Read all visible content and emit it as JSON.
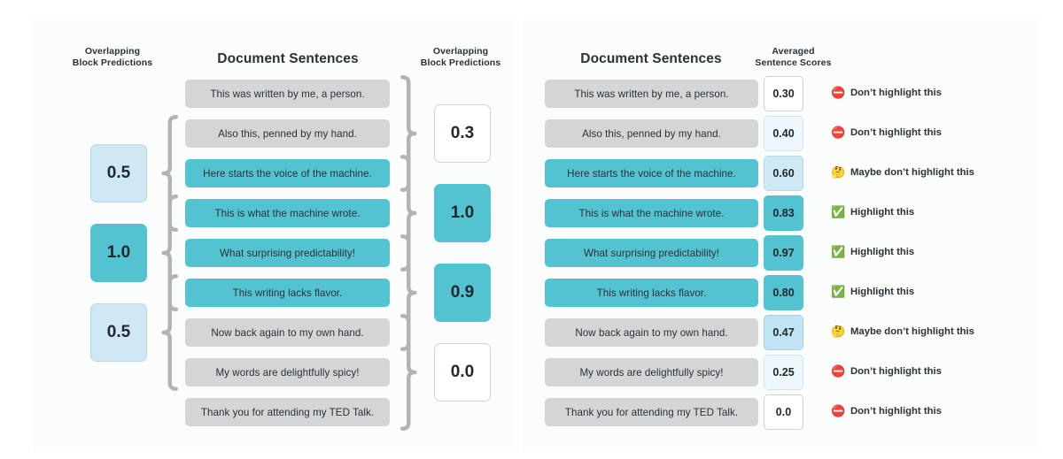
{
  "left_panel": {
    "headings": {
      "block_predictions_left": "Overlapping\nBlock Predictions",
      "document_sentences": "Document Sentences",
      "block_predictions_right": "Overlapping\nBlock Predictions"
    },
    "sentences": [
      {
        "text": "This was written by me, a person.",
        "highlighted": false
      },
      {
        "text": "Also this, penned by my hand.",
        "highlighted": false
      },
      {
        "text": "Here starts the voice of the machine.",
        "highlighted": true
      },
      {
        "text": "This is what the machine wrote.",
        "highlighted": true
      },
      {
        "text": "What surprising predictability!",
        "highlighted": true
      },
      {
        "text": "This writing lacks flavor.",
        "highlighted": true
      },
      {
        "text": "Now back again to my own hand.",
        "highlighted": false
      },
      {
        "text": "My words are delightfully spicy!",
        "highlighted": false
      },
      {
        "text": "Thank you for attending my TED Talk.",
        "highlighted": false
      }
    ],
    "left_blocks": [
      {
        "value": "0.5",
        "tint": "t-light",
        "covers": [
          1,
          2,
          3
        ]
      },
      {
        "value": "1.0",
        "tint": "t-full",
        "covers": [
          3,
          4,
          5
        ]
      },
      {
        "value": "0.5",
        "tint": "t-light",
        "covers": [
          5,
          6,
          7
        ]
      }
    ],
    "right_blocks": [
      {
        "value": "0.3",
        "tint": "t-white",
        "covers": [
          0,
          1,
          2
        ]
      },
      {
        "value": "1.0",
        "tint": "t-full",
        "covers": [
          2,
          3,
          4
        ]
      },
      {
        "value": "0.9",
        "tint": "t-full",
        "covers": [
          4,
          5,
          6
        ]
      },
      {
        "value": "0.0",
        "tint": "t-white",
        "covers": [
          6,
          7,
          8
        ]
      }
    ]
  },
  "right_panel": {
    "headings": {
      "document_sentences": "Document Sentences",
      "averaged_sentence_scores": "Averaged\nSentence Scores"
    },
    "rows": [
      {
        "text": "This was written by me, a person.",
        "highlighted": false,
        "score": "0.30",
        "tint": "t-white",
        "verdict": "Don’t highlight this",
        "emoji": "⛔",
        "emoji_name": "no-entry-icon",
        "emoji_class": "emoji-stop"
      },
      {
        "text": "Also this, penned by my hand.",
        "highlighted": false,
        "score": "0.40",
        "tint": "t-faint",
        "verdict": "Don’t highlight this",
        "emoji": "⛔",
        "emoji_name": "no-entry-icon",
        "emoji_class": "emoji-stop"
      },
      {
        "text": "Here starts the voice of the machine.",
        "highlighted": true,
        "score": "0.60",
        "tint": "t-light",
        "verdict": "Maybe don’t highlight this",
        "emoji": "🤔",
        "emoji_name": "thinking-face-icon",
        "emoji_class": "emoji-think"
      },
      {
        "text": "This is what the machine wrote.",
        "highlighted": true,
        "score": "0.83",
        "tint": "t-full",
        "verdict": "Highlight this",
        "emoji": "✅",
        "emoji_name": "check-mark-icon",
        "emoji_class": "emoji-check"
      },
      {
        "text": "What surprising predictability!",
        "highlighted": true,
        "score": "0.97",
        "tint": "t-full",
        "verdict": "Highlight this",
        "emoji": "✅",
        "emoji_name": "check-mark-icon",
        "emoji_class": "emoji-check"
      },
      {
        "text": "This writing lacks flavor.",
        "highlighted": true,
        "score": "0.80",
        "tint": "t-full",
        "verdict": "Highlight this",
        "emoji": "✅",
        "emoji_name": "check-mark-icon",
        "emoji_class": "emoji-check"
      },
      {
        "text": "Now back again to my own hand.",
        "highlighted": false,
        "score": "0.47",
        "tint": "t-mid",
        "verdict": "Maybe don’t highlight this",
        "emoji": "🤔",
        "emoji_name": "thinking-face-icon",
        "emoji_class": "emoji-think"
      },
      {
        "text": "My words are delightfully spicy!",
        "highlighted": false,
        "score": "0.25",
        "tint": "t-faint",
        "verdict": "Don’t highlight this",
        "emoji": "⛔",
        "emoji_name": "no-entry-icon",
        "emoji_class": "emoji-stop"
      },
      {
        "text": "Thank you for attending my TED Talk.",
        "highlighted": false,
        "score": "0.0",
        "tint": "t-white",
        "verdict": "Don’t highlight this",
        "emoji": "⛔",
        "emoji_name": "no-entry-icon",
        "emoji_class": "emoji-stop"
      }
    ]
  },
  "colors": {
    "highlight_teal": "#54c3d1",
    "plain_gray": "#d3d5d6",
    "brace_gray": "#b0b4b6",
    "light_blue": "#cfe9f4",
    "text_dark": "#2b3137"
  }
}
